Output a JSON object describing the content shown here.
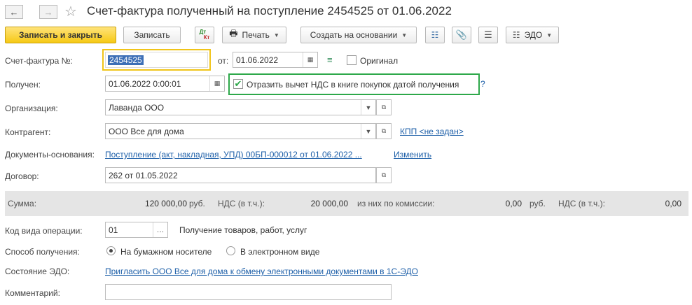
{
  "title": "Счет-фактура полученный на поступление 2454525 от 01.06.2022",
  "toolbar": {
    "save_close": "Записать и закрыть",
    "save": "Записать",
    "print": "Печать",
    "create_based": "Создать на основании",
    "edo": "ЭДО",
    "dt_kt_top": "Дт",
    "dt_kt_bottom": "Кт"
  },
  "form": {
    "invoice_label": "Счет-фактура №:",
    "invoice_number": "2454525",
    "from_label": "от:",
    "from_date": "01.06.2022",
    "original_label": "Оригинал",
    "received_label": "Получен:",
    "received_date": "01.06.2022  0:00:01",
    "vat_deduction_label": "Отразить вычет НДС в книге покупок датой получения",
    "help": "?",
    "org_label": "Организация:",
    "org_value": "Лаванда ООО",
    "contractor_label": "Контрагент:",
    "contractor_value": "ООО Все для дома",
    "kpp_link": "КПП <не задан>",
    "docs_label": "Документы-основания:",
    "docs_link": "Поступление (акт, накладная, УПД) 00БП-000012 от 01.06.2022 ...",
    "change_link": "Изменить",
    "contract_label": "Договор:",
    "contract_value": "262 от 01.05.2022"
  },
  "totals": {
    "sum_label": "Сумма:",
    "sum_value": "120 000,00",
    "currency1": "руб.",
    "vat_label": "НДС (в т.ч.):",
    "vat_value": "20 000,00",
    "commission_label": "из них по комиссии:",
    "commission_value": "0,00",
    "currency2": "руб.",
    "vat_label2": "НДС (в т.ч.):",
    "vat_value2": "0,00"
  },
  "operation": {
    "code_label": "Код вида операции:",
    "code_value": "01",
    "code_desc": "Получение товаров, работ, услуг",
    "method_label": "Способ получения:",
    "method_paper": "На бумажном носителе",
    "method_electronic": "В электронном виде",
    "method_selected": "paper",
    "edo_label": "Состояние ЭДО:",
    "edo_link": "Пригласить ООО Все для дома к обмену электронными документами в 1С-ЭДО",
    "comment_label": "Комментарий:",
    "comment_value": ""
  },
  "colors": {
    "primary": "#f6c915",
    "link": "#1d5fa8",
    "highlight_yellow": "#f0c419",
    "highlight_green": "#2ea84a",
    "selection": "#3d6fb6"
  }
}
